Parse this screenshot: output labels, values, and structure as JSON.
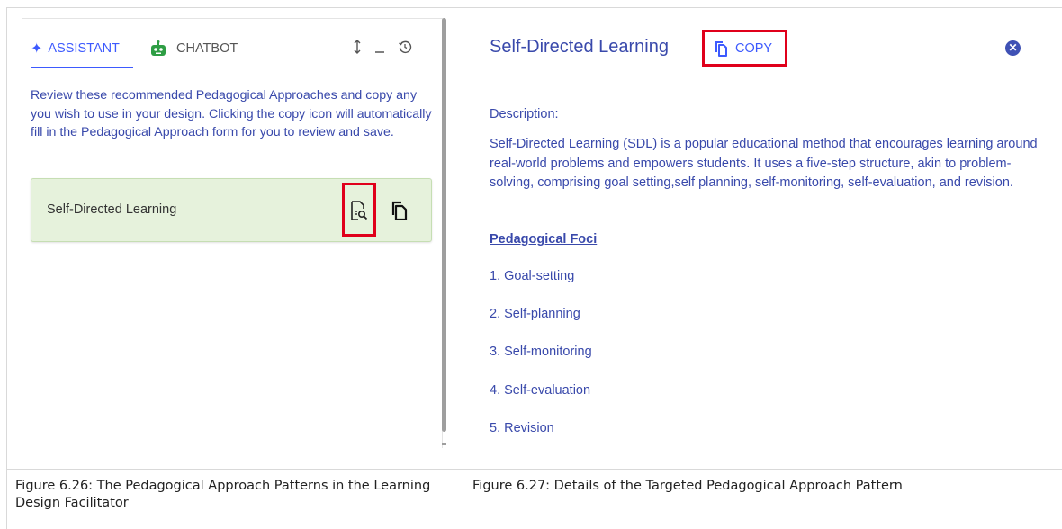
{
  "assistant_panel": {
    "tabs": [
      {
        "label": "ASSISTANT",
        "icon": "sparkle-icon",
        "active": true
      },
      {
        "label": "CHATBOT",
        "icon": "robot-icon",
        "active": false
      }
    ],
    "window_controls": [
      "resize-vertical-icon",
      "minimize-icon",
      "history-icon"
    ],
    "intro_text": "Review these recommended Pedagogical Approaches and copy any you wish to use in your design. Clicking the copy icon will automatically fill in the Pedagogical Approach form for you to review and save.",
    "card": {
      "title": "Self-Directed Learning",
      "icons": [
        "view-details-icon",
        "copy-icon"
      ]
    }
  },
  "detail_panel": {
    "title": "Self-Directed Learning",
    "copy_label": "COPY",
    "description_label": "Description:",
    "description": "Self-Directed Learning (SDL) is a popular educational method that encourages learning around real-world problems and empowers students. It uses a five-step structure, akin to problem-solving, comprising goal setting,self planning, self-monitoring, self-evaluation, and revision.",
    "foci_title": "Pedagogical Foci",
    "foci": [
      "1. Goal-setting",
      "2. Self-planning",
      "3. Self-monitoring",
      "4. Self-evaluation",
      "5. Revision"
    ]
  },
  "captions": {
    "left": "Figure 6.26: The Pedagogical Approach Patterns in the Learning Design Facilitator",
    "right": "Figure 6.27: Details of the Targeted Pedagogical Approach Pattern"
  },
  "colors": {
    "accent": "#3d5afe",
    "text_blue": "#3949ab",
    "card_bg": "#e6f2dc",
    "highlight_red": "#e0001b",
    "robot_green": "#2e9e44"
  }
}
